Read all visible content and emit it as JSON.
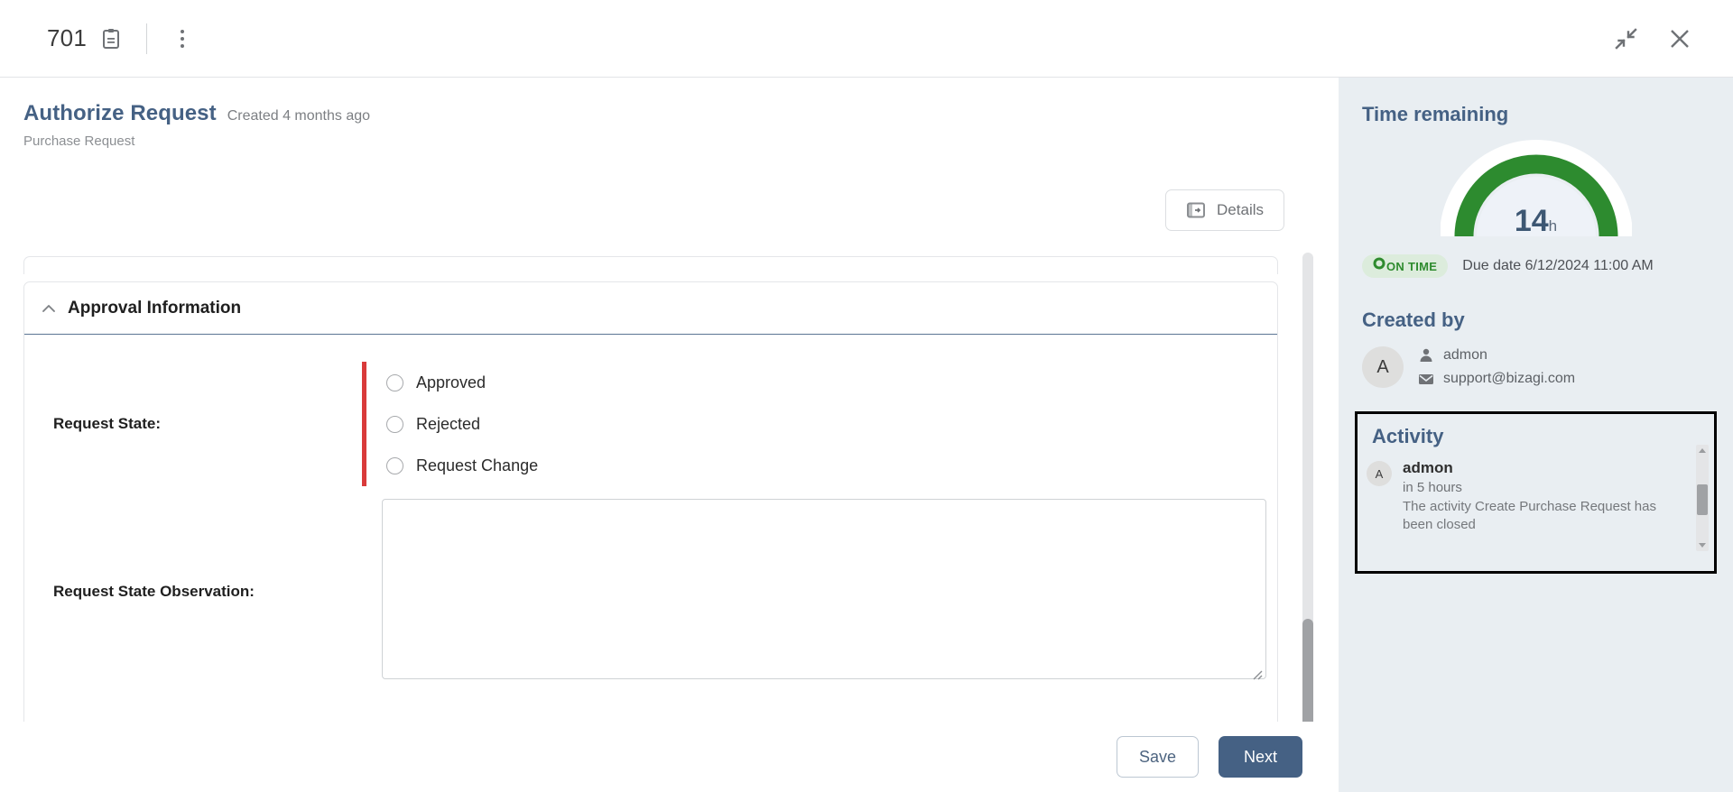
{
  "topbar": {
    "case_id": "701",
    "clipboard_icon": "clipboard-icon",
    "kebab_icon": "more-vertical-icon",
    "collapse_icon": "collapse-icon",
    "close_icon": "close-icon"
  },
  "case": {
    "title": "Authorize Request",
    "created": "Created 4 months ago",
    "process": "Purchase Request",
    "details_label": "Details",
    "details_icon": "panel-icon"
  },
  "form": {
    "section_title": "Approval Information",
    "collapse_icon": "chevron-up-icon",
    "request_state_label": "Request State:",
    "request_state_required": true,
    "required_color": "#d93a3a",
    "options": [
      {
        "label": "Approved",
        "selected": false
      },
      {
        "label": "Rejected",
        "selected": false
      },
      {
        "label": "Request Change",
        "selected": false
      }
    ],
    "observation_label": "Request State Observation:",
    "observation_value": "",
    "observation_placeholder": ""
  },
  "right_panel": {
    "time_remaining": {
      "heading": "Time remaining",
      "value": "14",
      "unit": "h",
      "gauge_percent": 100,
      "gauge_color": "#2d8b2f",
      "status_label": "ON TIME",
      "status_icon": "circle-icon",
      "status_color": "#2e8b2e",
      "due_date": "Due date 6/12/2024 11:00 AM"
    },
    "created_by": {
      "heading": "Created by",
      "avatar_initial": "A",
      "user_icon": "person-icon",
      "user_name": "admon",
      "mail_icon": "envelope-icon",
      "email": "support@bizagi.com"
    },
    "activity": {
      "heading": "Activity",
      "items": [
        {
          "avatar_initial": "A",
          "user": "admon",
          "when": "in 5 hours",
          "description": "The activity Create Purchase Request has been closed"
        }
      ]
    }
  },
  "footer": {
    "save_label": "Save",
    "next_label": "Next",
    "next_color": "#456184"
  }
}
